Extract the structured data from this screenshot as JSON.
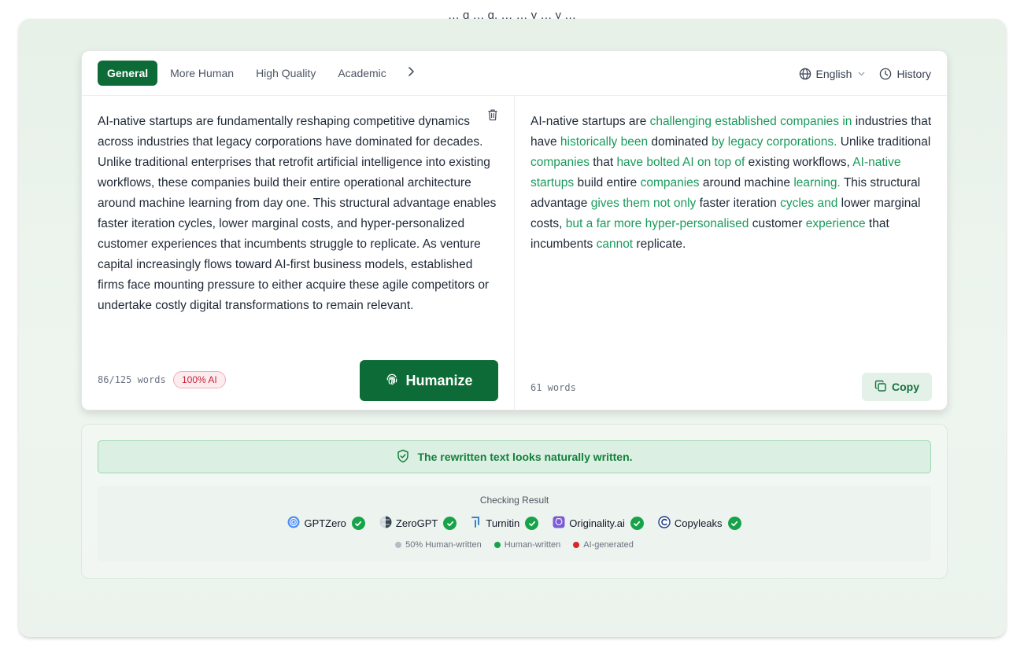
{
  "top_text": "… g … g, … … y … y …",
  "toolbar": {
    "tabs": [
      {
        "label": "General",
        "active": true
      },
      {
        "label": "More Human",
        "active": false
      },
      {
        "label": "High Quality",
        "active": false
      },
      {
        "label": "Academic",
        "active": false
      }
    ],
    "more_icon": "chevron-right-icon",
    "language": "English",
    "history": "History"
  },
  "input": {
    "text": "AI-native startups are fundamentally reshaping competitive dynamics across industries that legacy corporations have dominated for decades. Unlike traditional enterprises that retrofit artificial intelligence into existing workflows, these companies build their entire operational architecture around machine learning from day one. This structural advantage enables faster iteration cycles, lower marginal costs, and hyper-personalized customer experiences that incumbents struggle to replicate. As venture capital increasingly flows toward AI-first business models, established firms face mounting pressure to either acquire these agile competitors or undertake costly digital transformations to remain relevant.",
    "word_count": "86/125 words",
    "ai_badge": "100% AI",
    "humanize_label": "Humanize"
  },
  "output": {
    "segments": [
      {
        "t": "AI-native startups are ",
        "h": false
      },
      {
        "t": "challenging established companies in",
        "h": true
      },
      {
        "t": " industries that have ",
        "h": false
      },
      {
        "t": "historically been",
        "h": true
      },
      {
        "t": " dominated ",
        "h": false
      },
      {
        "t": "by legacy corporations.",
        "h": true
      },
      {
        "t": " Unlike traditional ",
        "h": false
      },
      {
        "t": "companies",
        "h": true
      },
      {
        "t": " that ",
        "h": false
      },
      {
        "t": "have bolted AI on top of",
        "h": true
      },
      {
        "t": " existing workflows, ",
        "h": false
      },
      {
        "t": "AI-native startups",
        "h": true
      },
      {
        "t": " build entire ",
        "h": false
      },
      {
        "t": "companies",
        "h": true
      },
      {
        "t": " around machine ",
        "h": false
      },
      {
        "t": "learning.",
        "h": true
      },
      {
        "t": " This structural advantage ",
        "h": false
      },
      {
        "t": "gives them not only",
        "h": true
      },
      {
        "t": " faster iteration ",
        "h": false
      },
      {
        "t": "cycles and",
        "h": true
      },
      {
        "t": " lower marginal costs, ",
        "h": false
      },
      {
        "t": "but a far more hyper-personalised",
        "h": true
      },
      {
        "t": " customer ",
        "h": false
      },
      {
        "t": "experience",
        "h": true
      },
      {
        "t": " that incumbents ",
        "h": false
      },
      {
        "t": "cannot",
        "h": true
      },
      {
        "t": " replicate.",
        "h": false
      }
    ],
    "word_count": "61 words",
    "copy_label": "Copy"
  },
  "results": {
    "status": "The rewritten text looks naturally written.",
    "checking_title": "Checking Result",
    "detectors": [
      {
        "name": "GPTZero",
        "icon": "gptzero-logo-icon",
        "passed": true
      },
      {
        "name": "ZeroGPT",
        "icon": "zerogpt-logo-icon",
        "passed": true
      },
      {
        "name": "Turnitin",
        "icon": "turnitin-logo-icon",
        "passed": true
      },
      {
        "name": "Originality.ai",
        "icon": "originality-logo-icon",
        "passed": true
      },
      {
        "name": "Copyleaks",
        "icon": "copyleaks-logo-icon",
        "passed": true
      }
    ],
    "legend": [
      {
        "label": "50% Human-written",
        "color": "#b7bcc2"
      },
      {
        "label": "Human-written",
        "color": "#16a34a"
      },
      {
        "label": "AI-generated",
        "color": "#dc2626"
      }
    ]
  },
  "colors": {
    "brand": "#0c6b36",
    "highlight": "#1a9a5c",
    "ai_badge": "#c81e3a"
  }
}
